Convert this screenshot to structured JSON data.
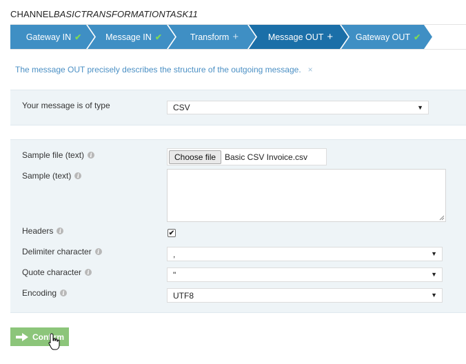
{
  "title": {
    "prefix": "CHANNEL",
    "italic": "BASICTRANSFORMATIONTASK11"
  },
  "steps": [
    {
      "label": "Gateway IN",
      "mark": "✔",
      "status": "done"
    },
    {
      "label": "Message IN",
      "mark": "✔",
      "status": "done"
    },
    {
      "label": "Transform",
      "mark": "+",
      "status": "pending"
    },
    {
      "label": "Message OUT",
      "mark": "+",
      "status": "active"
    },
    {
      "label": "Gateway OUT",
      "mark": "✔",
      "status": "done"
    }
  ],
  "colors": {
    "step_default": "#3f8fc4",
    "step_active": "#1b6fa8",
    "info_text": "#4a8fc4",
    "panel_bg": "#eef4f7",
    "confirm_bg": "#8cc57a",
    "check": "#7ed957"
  },
  "info": {
    "text": "The message OUT precisely describes the structure of the outgoing message.",
    "close": "×"
  },
  "message_type": {
    "label": "Your message is of type",
    "value": "CSV"
  },
  "form": {
    "sample_file": {
      "label": "Sample file (text)",
      "button": "Choose file",
      "filename": "Basic CSV Invoice.csv"
    },
    "sample_text": {
      "label": "Sample (text)",
      "value": ""
    },
    "headers": {
      "label": "Headers",
      "checked": true,
      "check_mark": "✔"
    },
    "delimiter": {
      "label": "Delimiter character",
      "value": ","
    },
    "quote": {
      "label": "Quote character",
      "value": "\""
    },
    "encoding": {
      "label": "Encoding",
      "value": "UTF8"
    }
  },
  "info_icon": "i",
  "confirm": {
    "label": "Confirm"
  },
  "icons": {
    "caret": "caret-down-icon",
    "arrow": "arrow-right-icon",
    "cursor": "hand-pointer-icon"
  }
}
